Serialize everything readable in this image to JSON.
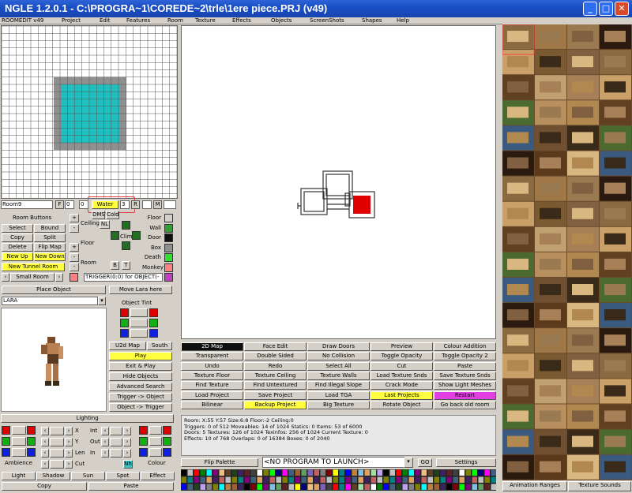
{
  "window": {
    "title": "NGLE 1.2.0.1 - C:\\PROGRA~1\\COREDE~2\\trle\\1ere piece.PRJ  (v49)"
  },
  "menu": [
    "ROOMEDIT v49",
    "Project",
    "Edit",
    "Features",
    "Room",
    "Texture",
    "Effects",
    "Objects",
    "ScreenShots",
    "Shapes",
    "Help"
  ],
  "room_bar": {
    "name": "Room9",
    "f_label": "F",
    "f_val": "0",
    "c_val": "0",
    "water_label": "Water",
    "water_val": "3",
    "r_label": "R",
    "m_label": "M"
  },
  "room_buttons": {
    "header": "Room Buttons",
    "rows": [
      [
        "Select",
        "Bound"
      ],
      [
        "Copy",
        "Split"
      ],
      [
        "Delete",
        "Flip Map"
      ],
      [
        "New Up",
        "New Down"
      ]
    ],
    "new_tunnel": "New Tunnel Room",
    "small_room": "Small Room"
  },
  "mid_labels": {
    "dms": "DMS",
    "cold": "Cold",
    "ceiling": "Ceiling",
    "nl": "NL",
    "floor": "Floor",
    "room": "Room",
    "b": "B",
    "t": "T",
    "climb": "Climb"
  },
  "legend": [
    {
      "name": "Floor",
      "color": "#d4d0c8"
    },
    {
      "name": "Wall",
      "color": "#30a030"
    },
    {
      "name": "Door",
      "color": "#101010"
    },
    {
      "name": "Box",
      "color": "#909090"
    },
    {
      "name": "Death",
      "color": "#30e030"
    },
    {
      "name": "Monkey",
      "color": "#ff8080"
    },
    {
      "name": "",
      "color": "#c040c0"
    }
  ],
  "trigger_text": "TRIGGER(0:0) for OBJECT(-",
  "place_object": "Place Object",
  "move_lara": "Move Lara here",
  "object_name": "LARA",
  "object_tint": "Object Tint",
  "obj_buttons": [
    "U2d Map",
    "South",
    "Play",
    "Exit & Play",
    "Hide Objects",
    "Advanced Search",
    "Trigger -> Object",
    "Object -> Trigger"
  ],
  "lighting": {
    "header": "Lighting",
    "labels": [
      "X",
      "Y",
      "Len",
      "Cut",
      "Int",
      "Out",
      "In"
    ],
    "ambience": "Ambience",
    "colour": "Colour",
    "nh": "Nh",
    "buttons": [
      "Light",
      "Shadow",
      "Sun",
      "Spot",
      "Effect"
    ],
    "copy": "Copy",
    "paste": "Paste"
  },
  "toolbar": [
    [
      "2D Map",
      "Face Edit",
      "Draw Doors",
      "Preview",
      "Colour Addition"
    ],
    [
      "Transparent",
      "Double Sided",
      "No Collision",
      "Toggle Opacity",
      "Toggle Opacity 2"
    ],
    [
      "Undo",
      "Redo",
      "Select All",
      "Cut",
      "Paste"
    ],
    [
      "Texture Floor",
      "Texture Ceiling",
      "Texture Walls",
      "Load Texture Snds",
      "Save Texture Snds"
    ],
    [
      "Find Texture",
      "Find Untextured",
      "Find Illegal Slope",
      "Crack Mode",
      "Show Light Meshes"
    ],
    [
      "Load Project",
      "Save Project",
      "Load TGA",
      "Last Projects",
      "Restart"
    ],
    [
      "Bilinear",
      "Backup Project",
      "Big Texture",
      "Rotate Object",
      "Go back old room"
    ]
  ],
  "status_lines": [
    "Room: X:55 Y:57    Size:6:8      Floor:-2 Ceiling:0",
    "Triggers: 0 of 512    Moveables: 14 of 1024    Statics: 0    Items: 53 of 6000",
    "Doors: 5    Textures: 126 of 1024    Texinfos: 256 of 1024    Current Texture: 0",
    "Effects: 10 of 768  Overlaps: 0 of 16384  Boxes: 0 of 2040"
  ],
  "bottom": {
    "flip_palette": "Flip Palette",
    "program": "<NO PROGRAM TO LAUNCH>",
    "go": "GO",
    "settings": "Settings"
  },
  "right_tabs": {
    "animation": "Animation Ranges",
    "texture_sounds": "Texture Sounds"
  },
  "colors": {
    "water": "#20c0c0",
    "selected": "#e00000"
  }
}
